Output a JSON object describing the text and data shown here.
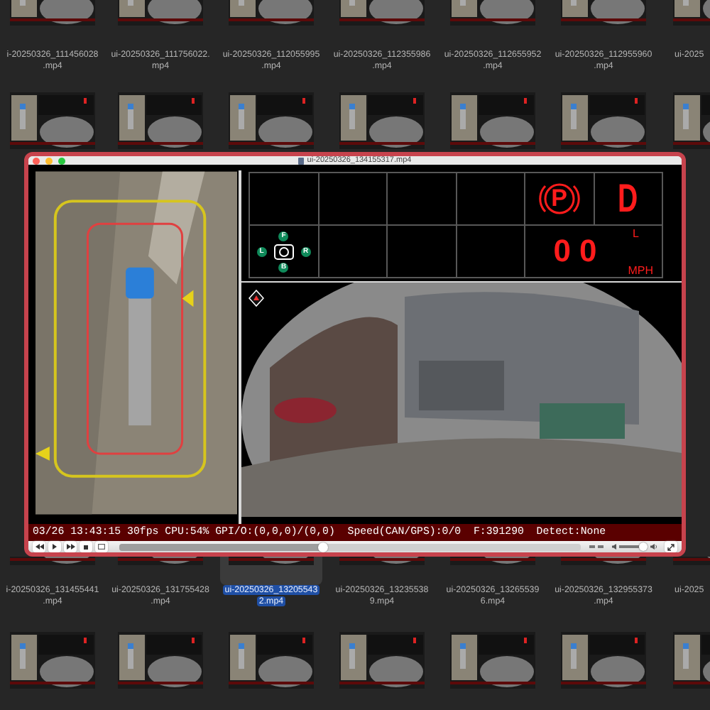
{
  "file_grid": {
    "upper_labels": [
      {
        "lines": [
          "i-20250326_111456028",
          ".mp4"
        ],
        "selected": false
      },
      {
        "lines": [
          "ui-20250326_111756022.",
          "mp4"
        ],
        "selected": false
      },
      {
        "lines": [
          "ui-20250326_112055995",
          ".mp4"
        ],
        "selected": false
      },
      {
        "lines": [
          "ui-20250326_112355986",
          ".mp4"
        ],
        "selected": false
      },
      {
        "lines": [
          "ui-20250326_112655952",
          ".mp4"
        ],
        "selected": false
      },
      {
        "lines": [
          "ui-20250326_112955960",
          ".mp4"
        ],
        "selected": false
      },
      {
        "lines": [
          "ui-2025"
        ],
        "selected": false
      }
    ],
    "lower_labels": [
      {
        "lines": [
          "i-20250326_131455441",
          ".mp4"
        ],
        "selected": false
      },
      {
        "lines": [
          "ui-20250326_131755428",
          ".mp4"
        ],
        "selected": false
      },
      {
        "lines": [
          "ui-20250326_13205543",
          "2.mp4"
        ],
        "selected": true
      },
      {
        "lines": [
          "ui-20250326_13235538",
          "9.mp4"
        ],
        "selected": false
      },
      {
        "lines": [
          "ui-20250326_13265539",
          "6.mp4"
        ],
        "selected": false
      },
      {
        "lines": [
          "ui-20250326_132955373",
          ".mp4"
        ],
        "selected": false
      },
      {
        "lines": [
          "ui-2025"
        ],
        "selected": false
      }
    ]
  },
  "player": {
    "title": "ui-20250326_134155317.mp4",
    "dashboard": {
      "parking_brake": {
        "label": "P",
        "on": true
      },
      "gear": "D",
      "speed": "00",
      "indicator": "L",
      "unit": "MPH",
      "camera_labels": [
        "F",
        "L",
        "R",
        "B"
      ]
    },
    "status_text": "03/26 13:43:15 30fps CPU:54% GPI/O:(0,0,0)/(0,0)  Speed(CAN/GPS):0/0  F:391290  Detect:None",
    "seek": {
      "level": 0.44
    },
    "volume": {
      "level": 0.85
    }
  }
}
